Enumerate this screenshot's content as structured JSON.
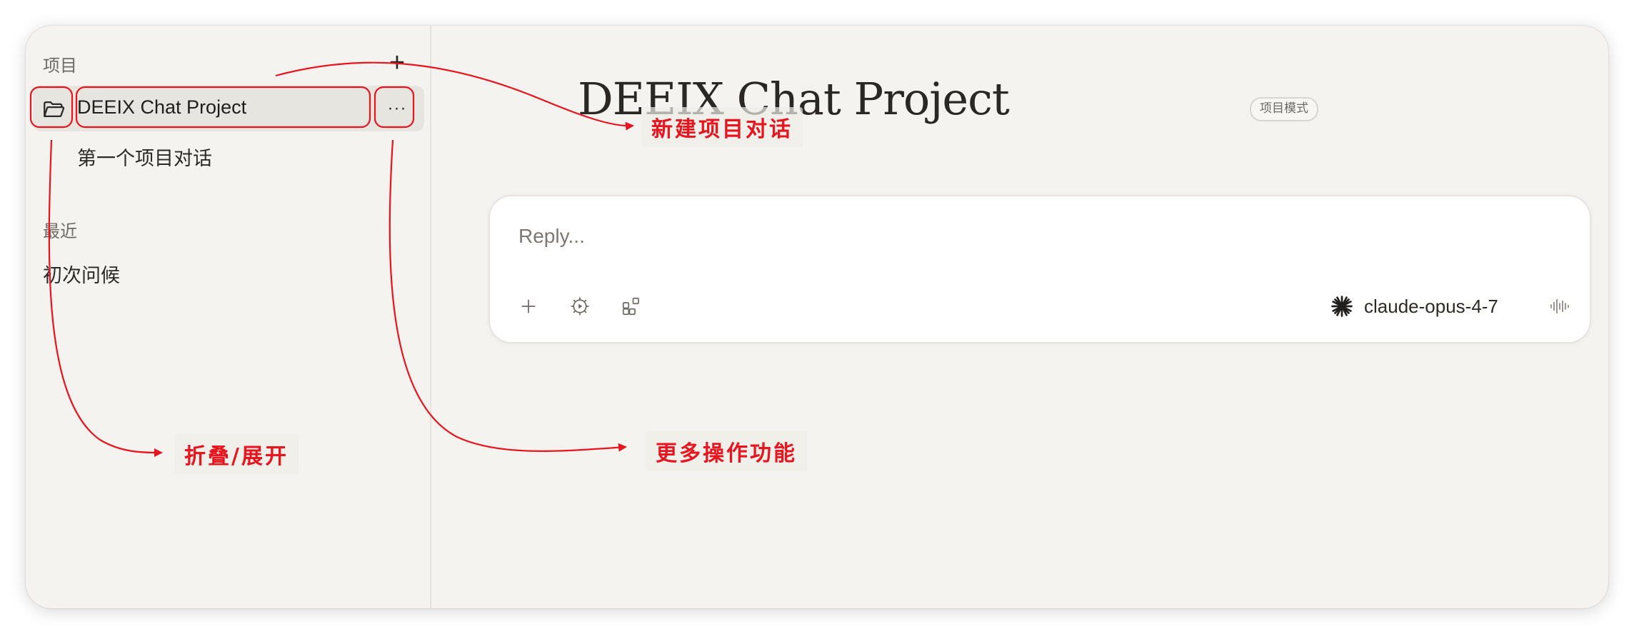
{
  "sidebar": {
    "projects_label": "项目",
    "new_project_icon": "plus-icon",
    "project": {
      "name": "DEEIX Chat Project",
      "icon": "folder-open-icon",
      "more_icon": "ellipsis-icon",
      "more_label": "···",
      "conversations": [
        "第一个项目对话"
      ]
    },
    "recent_label": "最近",
    "recent_items": [
      "初次问候"
    ]
  },
  "main": {
    "title": "DEEIX Chat Project",
    "mode_badge": "项目模式",
    "composer": {
      "placeholder": "Reply...",
      "tools": [
        "plus-icon",
        "settings-play-icon",
        "apps-add-icon"
      ],
      "model": "claude-opus-4-7",
      "model_icon": "claude-spark-icon",
      "voice_icon": "voice-waveform-icon"
    }
  },
  "annotations": {
    "new_conversation": "新建项目对话",
    "collapse_expand": "折叠/展开",
    "more_actions": "更多操作功能",
    "color": "#e8141e"
  }
}
